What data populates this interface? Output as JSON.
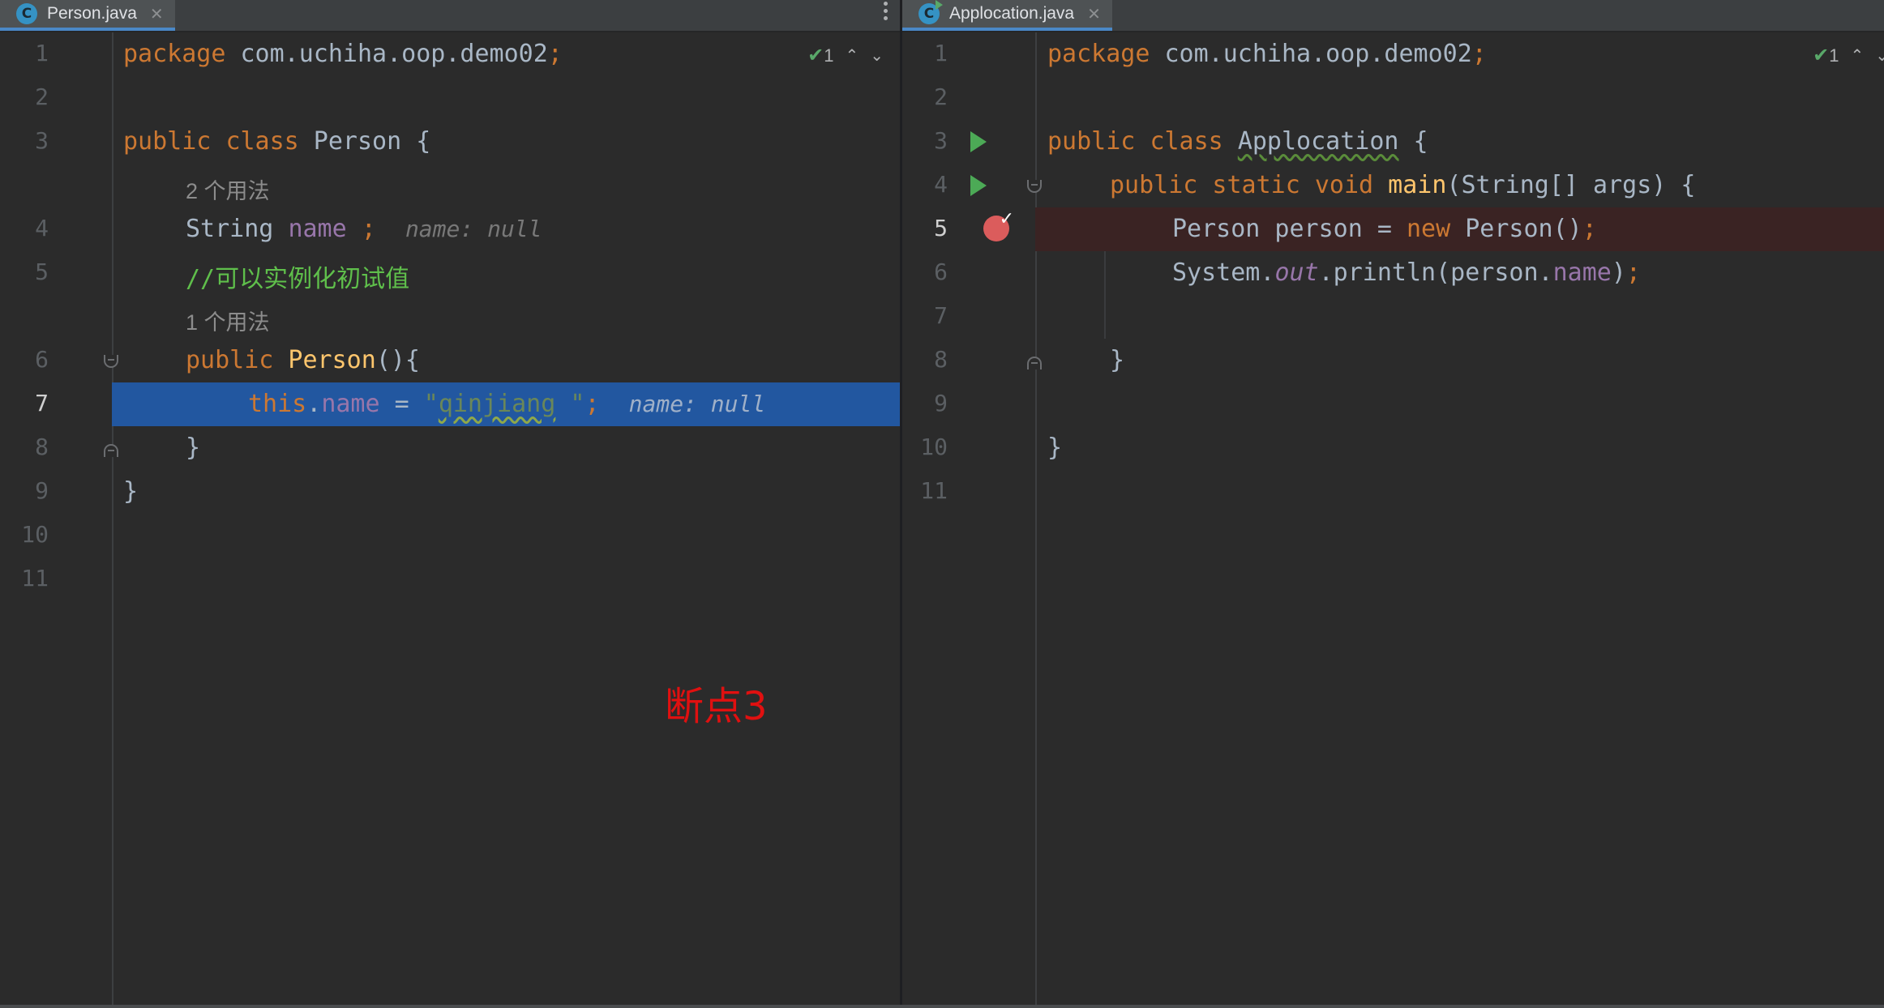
{
  "left_editor": {
    "tab": {
      "icon_letter": "C",
      "label": "Person.java",
      "close": "✕"
    },
    "inspection": {
      "count": "1"
    },
    "hint_usages_2": "2 个用法",
    "hint_usages_1": "1 个用法",
    "annotation": "断点3",
    "line_numbers": [
      "1",
      "2",
      "3",
      "4",
      "5",
      "6",
      "7",
      "8",
      "9",
      "10",
      "11"
    ],
    "code": {
      "l1_kw": "package",
      "l1_rest": " com.uchiha.oop.demo02",
      "l1_semi": ";",
      "l3_kw1": "public",
      "l3_kw2": "class",
      "l3_name": " Person {",
      "l4_type": "String ",
      "l4_field": "name",
      "l4_semi": " ;",
      "l4_inlay": "name: null",
      "l5_comment": "//可以实例化初试值",
      "l6_kw": "public",
      "l6_fn": " Person",
      "l6_rest": "(){",
      "l7_this": "this",
      "l7_dot": ".",
      "l7_field": "name",
      "l7_eq": " = ",
      "l7_q1": "\"",
      "l7_str": "qinjiang",
      "l7_q2": " \"",
      "l7_semi": ";",
      "l7_inlay": "name: null",
      "l8": "}",
      "l9": "}"
    }
  },
  "right_editor": {
    "tab": {
      "icon_letter": "C",
      "label": "Applocation.java",
      "close": "✕"
    },
    "inspection": {
      "count": "1"
    },
    "line_numbers": [
      "1",
      "2",
      "3",
      "4",
      "5",
      "6",
      "7",
      "8",
      "9",
      "10",
      "11"
    ],
    "code": {
      "l1_kw": "package",
      "l1_rest": " com.uchiha.oop.demo02",
      "l1_semi": ";",
      "l3_kw1": "public",
      "l3_kw2": "class",
      "l3_name": "Applocation",
      "l3_brace": " {",
      "l4_kw": "public static void",
      "l4_fn": " main",
      "l4_rest": "(String[] args) {",
      "l5_type": "Person person = ",
      "l5_kw": "new",
      "l5_rest": " Person()",
      "l5_semi": ";",
      "l6_sys": "System.",
      "l6_out": "out",
      "l6_print": ".println(person.",
      "l6_field": "name",
      "l6_close": ")",
      "l6_semi": ";",
      "l8": "}",
      "l10": "}"
    }
  },
  "colors": {
    "background": "#2b2b2b",
    "keyword": "#cc7832",
    "field": "#9876aa",
    "function": "#ffc66d",
    "string": "#6a8759",
    "current_line": "#2257a0",
    "breakpoint_line": "#3a2323",
    "annotation": "#e01010"
  }
}
